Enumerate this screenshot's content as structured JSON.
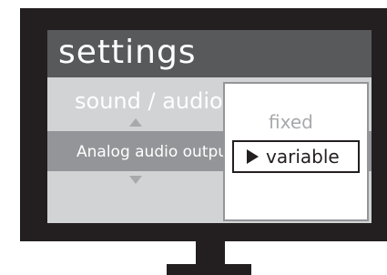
{
  "screen": {
    "title": "settings",
    "section_label": "sound / audio",
    "row_label": "Analog audio output"
  },
  "popup": {
    "options": [
      {
        "label": "fixed",
        "selected": false
      },
      {
        "label": "variable",
        "selected": true
      }
    ]
  },
  "icons": {
    "up": "triangle-up-icon",
    "down": "triangle-down-icon",
    "selected": "play-triangle-icon"
  },
  "colors": {
    "bezel": "#231f20",
    "title_bar": "#58595b",
    "highlight": "#939598",
    "menu_bg": "#d1d3d4",
    "dim_text": "#a7a9ac"
  }
}
